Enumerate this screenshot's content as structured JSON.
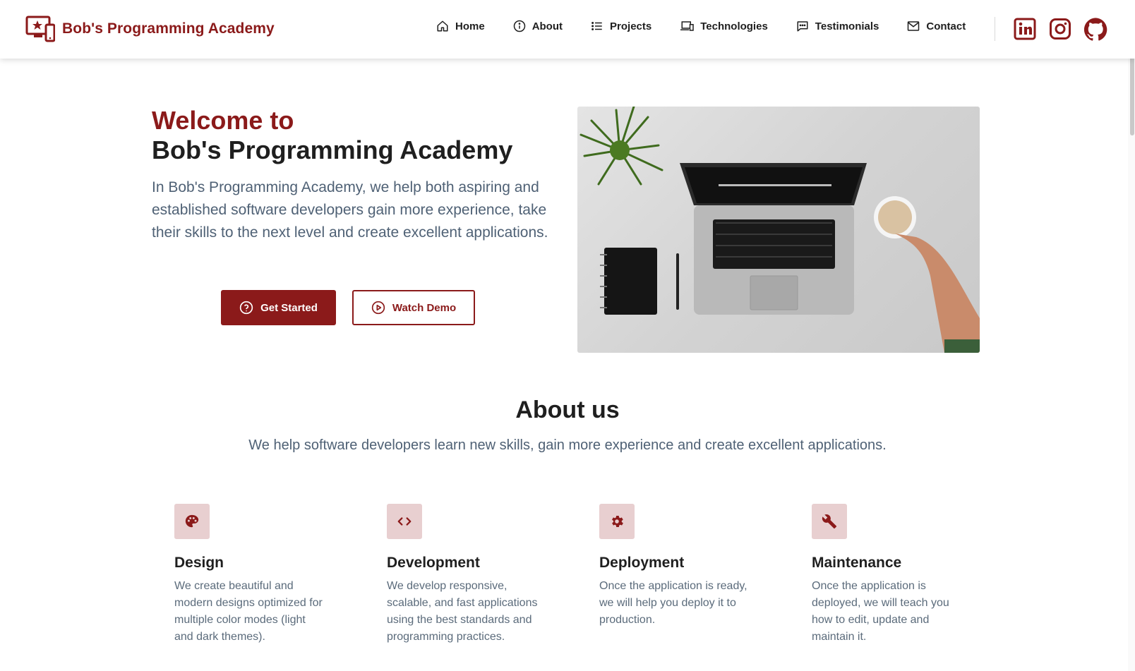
{
  "header": {
    "brand": "Bob's Programming Academy",
    "nav": [
      {
        "label": "Home",
        "icon": "home-icon"
      },
      {
        "label": "About",
        "icon": "info-icon"
      },
      {
        "label": "Projects",
        "icon": "list-icon"
      },
      {
        "label": "Technologies",
        "icon": "devices-icon"
      },
      {
        "label": "Testimonials",
        "icon": "chat-icon"
      },
      {
        "label": "Contact",
        "icon": "mail-icon"
      }
    ],
    "social": [
      "linkedin-icon",
      "instagram-icon",
      "github-icon"
    ]
  },
  "hero": {
    "title_line1": "Welcome to",
    "title_line2": "Bob's Programming Academy",
    "description": "In Bob's Programming Academy, we help both aspiring and established software developers gain more experience, take their skills to the next level and create excellent applications.",
    "primary_button": "Get Started",
    "secondary_button": "Watch Demo"
  },
  "about": {
    "title": "About us",
    "subtitle": "We help software developers learn new skills, gain more experience and create excellent applications.",
    "features": [
      {
        "title": "Design",
        "text": "We create beautiful and modern designs optimized for multiple color modes (light and dark themes).",
        "icon": "palette-icon"
      },
      {
        "title": "Development",
        "text": "We develop responsive, scalable, and fast applications using the best standards and programming practices.",
        "icon": "code-icon"
      },
      {
        "title": "Deployment",
        "text": "Once the application is ready, we will help you deploy it to production.",
        "icon": "gear-icon"
      },
      {
        "title": "Maintenance",
        "text": "Once the application is deployed, we will teach you how to edit, update and maintain it.",
        "icon": "wrench-icon"
      }
    ]
  },
  "colors": {
    "accent": "#8b1a1a",
    "accent_light": "#e8cfd0",
    "muted_text": "#4f6175"
  }
}
